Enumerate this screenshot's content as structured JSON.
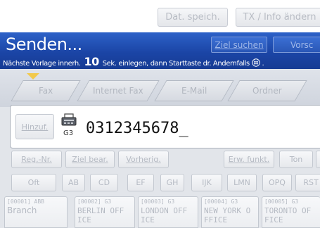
{
  "top_bar": {
    "store_file_label": "Dat. speich.",
    "tx_info_label": "TX / Info ändern"
  },
  "header": {
    "title": "Senden...",
    "instruction_before": "Nächste Vorlage innerh.",
    "instruction_number": "10",
    "instruction_after": "Sek. einlegen, dann Starttaste dr. Andernfalls",
    "instruction_icon": "#-key-icon",
    "dest_search_label": "Ziel suchen",
    "preview_label": "Vorsc"
  },
  "tabs": [
    {
      "label": "Fax"
    },
    {
      "label": "Internet Fax"
    },
    {
      "label": "E-Mail"
    },
    {
      "label": "Ordner"
    }
  ],
  "destination": {
    "add_label": "Hinzuf.",
    "mode": "G3",
    "number": "0312345678_"
  },
  "controls": {
    "reg_no": "Reg.-Nr.",
    "edit_dest": "Ziel bear.",
    "previous": "Vorherig.",
    "ext_func": "Erw. funkt.",
    "tone": "Ton"
  },
  "index_tabs": [
    "Oft",
    "AB",
    "CD",
    "EF",
    "GH",
    "IJK",
    "LMN",
    "OPQ",
    "RST"
  ],
  "entries": [
    {
      "code": "[00001] ABB",
      "name": "Branch"
    },
    {
      "code": "[00002] G3",
      "name": "BERLIN OFF\nICE"
    },
    {
      "code": "[00003] G3",
      "name": "LONDON OFF\nICE"
    },
    {
      "code": "[00004] G3",
      "name": "NEW YORK O\nFFICE"
    },
    {
      "code": "[00005] G3",
      "name": "TORONTO OF\nFICE"
    }
  ]
}
